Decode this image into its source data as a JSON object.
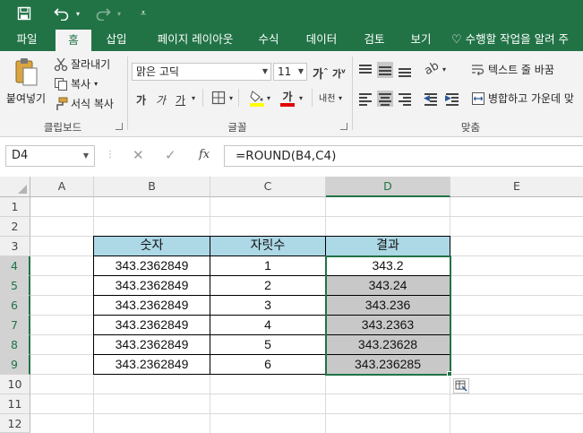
{
  "quick_access": {
    "save_icon": "save-icon",
    "undo_icon": "undo-icon",
    "redo_icon": "redo-icon",
    "customize_icon": "customize-icon"
  },
  "tabs": [
    {
      "label": "파일"
    },
    {
      "label": "홈"
    },
    {
      "label": "삽입"
    },
    {
      "label": "페이지 레이아웃"
    },
    {
      "label": "수식"
    },
    {
      "label": "데이터"
    },
    {
      "label": "검토"
    },
    {
      "label": "보기"
    }
  ],
  "tell_me": "수행할 작업을 알려 주",
  "clipboard": {
    "paste": "붙여넣기",
    "cut": "잘라내기",
    "copy": "복사",
    "format_painter": "서식 복사",
    "label": "클립보드"
  },
  "font": {
    "name": "맑은 고딕",
    "size": "11",
    "bold": "가",
    "italic": "가",
    "underline": "가",
    "grow": "가",
    "shrink": "가",
    "font_color_glyph": "가",
    "phonetic": "내천",
    "label": "글꼴"
  },
  "alignment": {
    "wrap_text": "텍스트 줄 바꿈",
    "merge_center": "병합하고 가운데 맞",
    "label": "맞춤"
  },
  "formula_bar": {
    "name_box": "D4",
    "fx": "fx",
    "formula": "=ROUND(B4,C4)"
  },
  "grid": {
    "columns": [
      "A",
      "B",
      "C",
      "D",
      "E"
    ],
    "rows": [
      "1",
      "2",
      "3",
      "4",
      "5",
      "6",
      "7",
      "8",
      "9",
      "10",
      "11",
      "12"
    ],
    "selected_column": "D",
    "selected_rows": [
      "4",
      "5",
      "6",
      "7",
      "8",
      "9"
    ]
  },
  "table": {
    "headers": [
      "숫자",
      "자릿수",
      "결과"
    ],
    "rows": [
      [
        "343.2362849",
        "1",
        "343.2"
      ],
      [
        "343.2362849",
        "2",
        "343.24"
      ],
      [
        "343.2362849",
        "3",
        "343.236"
      ],
      [
        "343.2362849",
        "4",
        "343.2363"
      ],
      [
        "343.2362849",
        "5",
        "343.23628"
      ],
      [
        "343.2362849",
        "6",
        "343.236285"
      ]
    ]
  },
  "colors": {
    "accent": "#217346",
    "header_fill": "#add8e6",
    "result_fill": "#c8c8c8"
  }
}
